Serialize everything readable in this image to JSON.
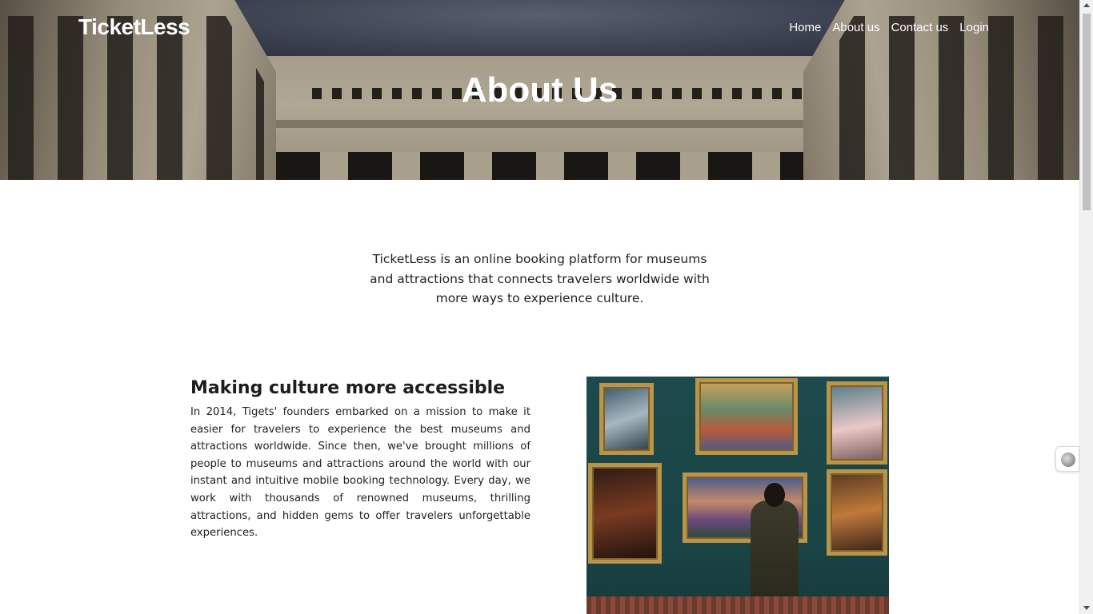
{
  "header": {
    "brand": "TicketLess",
    "nav": [
      "Home",
      "About us",
      "Contact us",
      "Login"
    ],
    "hero_title": "About Us"
  },
  "intro": {
    "text": "TicketLess is an online booking platform for museums and attractions that connects travelers worldwide with more ways to experience culture."
  },
  "feature": {
    "title": "Making culture more accessible",
    "text": "In 2014, Tigets' founders embarked on a mission to make it easier for travelers to experience the best museums and attractions worldwide. Since then, we've brought millions of people to museums and attractions around the world with our instant and intuitive mobile booking technology. Every day, we work with thousands of renowned museums, thrilling attractions, and hidden gems to offer travelers unforgettable experiences."
  },
  "icons": {
    "side_widget": "widget-icon"
  }
}
